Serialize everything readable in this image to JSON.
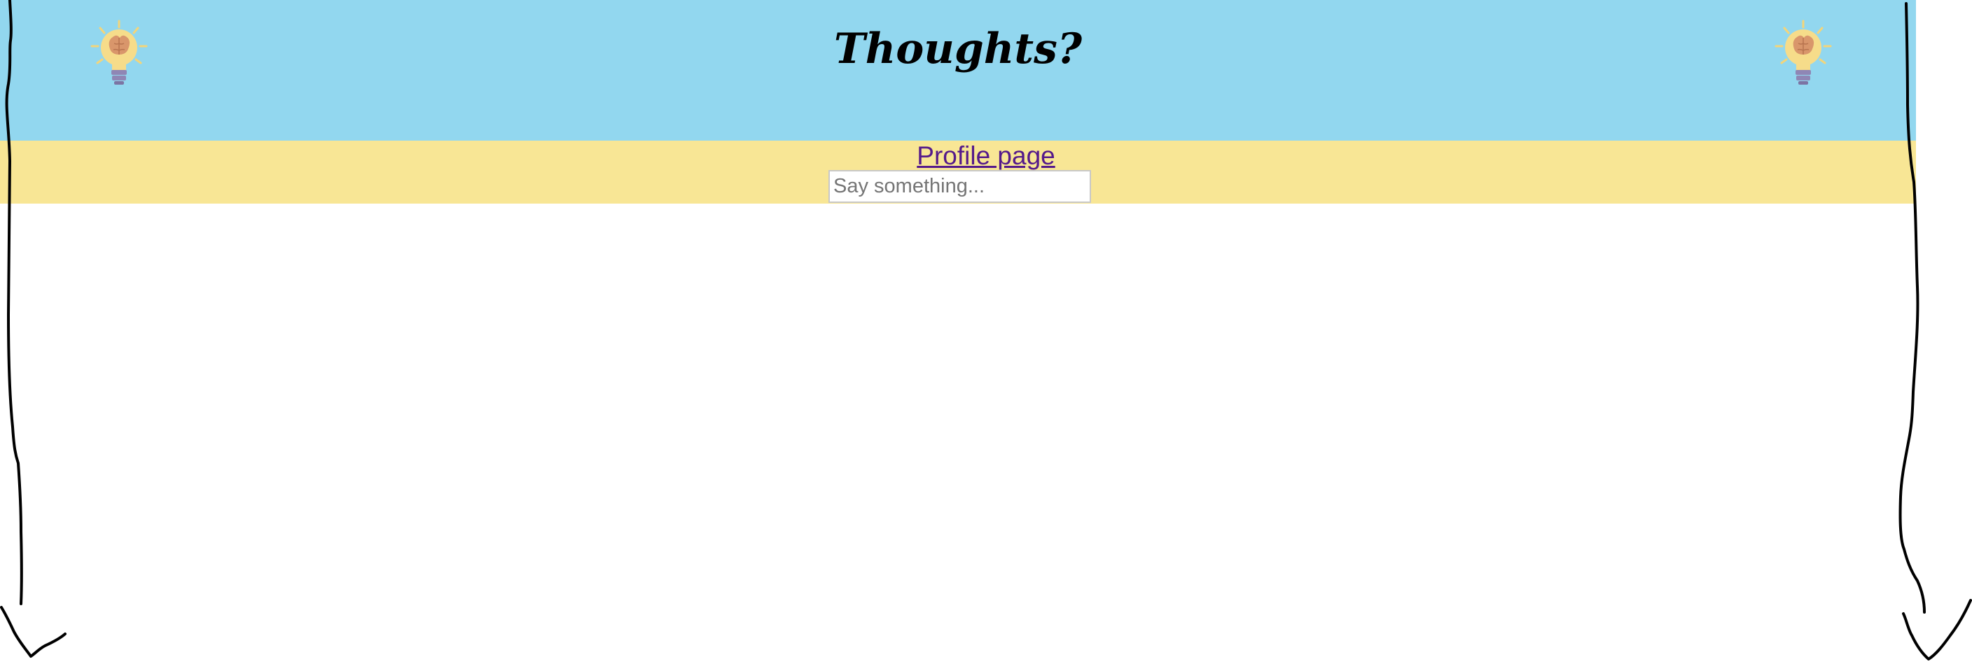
{
  "header": {
    "title": "Thoughts?",
    "background_color": "#92d7ef",
    "left_icon": "lightbulb-brain-icon",
    "right_icon": "lightbulb-brain-icon"
  },
  "subbar": {
    "background_color": "#f8e695",
    "profile_link_label": "Profile page",
    "link_color": "#551a8b"
  },
  "composer": {
    "placeholder": "Say something...",
    "value": ""
  },
  "decorations": {
    "left_arrow": "hand-drawn-down-arrow-icon",
    "right_arrow": "hand-drawn-down-arrow-icon"
  }
}
